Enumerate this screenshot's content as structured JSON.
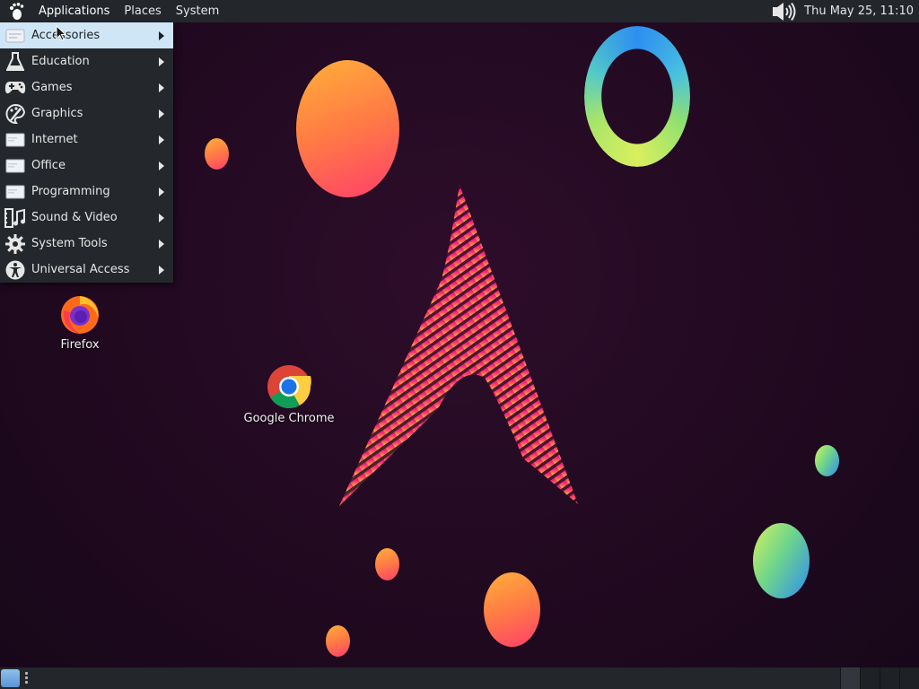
{
  "top_panel": {
    "menus": [
      "Applications",
      "Places",
      "System"
    ],
    "clock": "Thu May 25, 11:10",
    "icons": {
      "logo": "gnome-foot-icon",
      "volume": "volume-icon"
    }
  },
  "app_menu": {
    "items": [
      {
        "label": "Accessories",
        "icon": "accessories-icon"
      },
      {
        "label": "Education",
        "icon": "flask-icon"
      },
      {
        "label": "Games",
        "icon": "gamepad-icon"
      },
      {
        "label": "Graphics",
        "icon": "palette-icon"
      },
      {
        "label": "Internet",
        "icon": "internet-icon"
      },
      {
        "label": "Office",
        "icon": "office-icon"
      },
      {
        "label": "Programming",
        "icon": "programming-icon"
      },
      {
        "label": "Sound & Video",
        "icon": "film-music-icon"
      },
      {
        "label": "System Tools",
        "icon": "gear-icon"
      },
      {
        "label": "Universal Access",
        "icon": "accessibility-icon"
      }
    ],
    "highlighted": "Accessories"
  },
  "desktop": {
    "icons": [
      {
        "label": "Firefox",
        "icon": "firefox-icon"
      },
      {
        "label": "Google Chrome",
        "icon": "chrome-icon"
      }
    ]
  },
  "bottom_panel": {
    "icons": {
      "show_desktop": "show-desktop-icon",
      "handle": "panel-handle-icon"
    }
  },
  "colors": {
    "panel": "#23262b",
    "menu_bg": "#24272c",
    "menu_highlight": "#cfe6f6",
    "wallpaper": "#230a22",
    "arch_pink": "#ff2a7a",
    "arch_yellow": "#ffd23a"
  }
}
